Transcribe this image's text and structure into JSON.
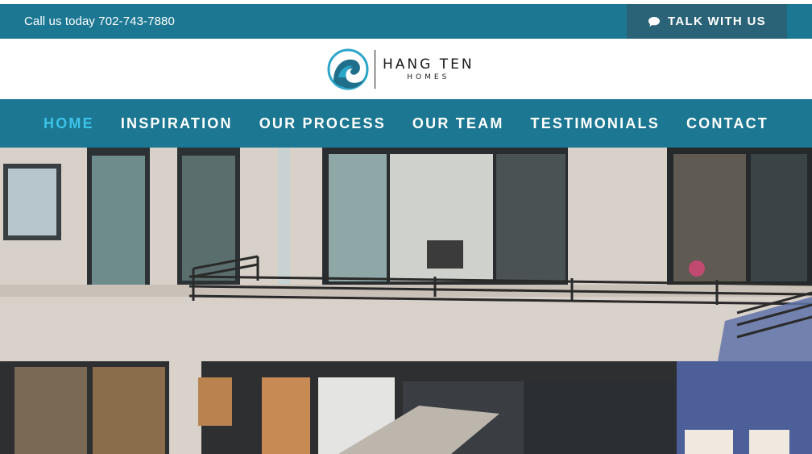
{
  "topbar": {
    "call_text": "Call us today 702-743-7880",
    "talk_label": "TALK WITH US",
    "talk_icon": "chat-bubble-icon"
  },
  "logo": {
    "line1": "HANG TEN",
    "line2": "HOMES",
    "icon": "wave-logo-icon"
  },
  "nav": {
    "items": [
      {
        "label": "HOME",
        "active": true
      },
      {
        "label": "INSPIRATION"
      },
      {
        "label": "OUR PROCESS"
      },
      {
        "label": "OUR TEAM"
      },
      {
        "label": "TESTIMONIALS"
      },
      {
        "label": "CONTACT"
      }
    ]
  },
  "colors": {
    "brand_teal": "#1c7792",
    "button_dark": "#2a6378",
    "active_nav": "#3cc3e7"
  }
}
